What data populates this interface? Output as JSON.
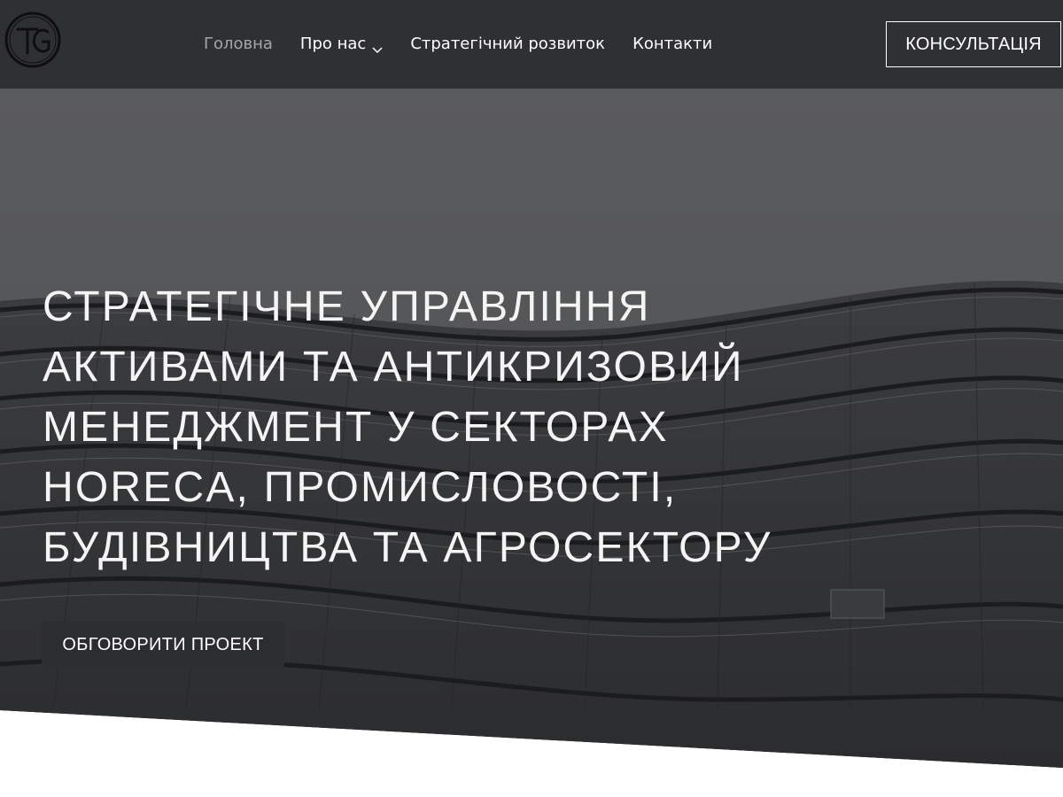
{
  "header": {
    "logo_alt": "TG",
    "nav": [
      {
        "label": "Головна",
        "active": true
      },
      {
        "label": "Про нас",
        "has_dropdown": true
      },
      {
        "label": "Стратегічний розвиток"
      },
      {
        "label": "Контакти"
      }
    ],
    "cta_label": "КОНСУЛЬТАЦІЯ"
  },
  "hero": {
    "headline_lines": [
      "СТРАТЕГІЧНЕ УПРАВЛІННЯ",
      "АКТИВАМИ ТА АНТИКРИЗОВИЙ",
      "МЕНЕДЖМЕНТ У СЕКТОРАХ",
      "HORECA, ПРОМИСЛОВОСТІ,",
      "БУДІВНИЦТВА ТА АГРОСЕКТОРУ"
    ],
    "button_label": "ОБГОВОРИТИ ПРОЕКТ"
  },
  "colors": {
    "header_bg": "#2f3034",
    "nav_active": "#a4a6aa",
    "text": "#ffffff",
    "hero_button_bg": "#2c2d30"
  }
}
